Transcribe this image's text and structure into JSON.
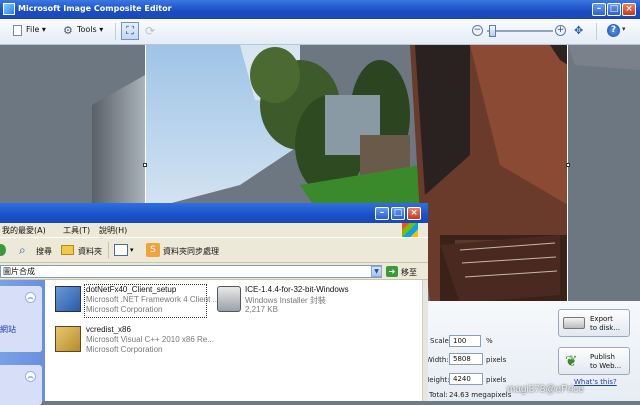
{
  "app": {
    "title": "Microsoft Image Composite Editor"
  },
  "toolbar": {
    "file_label": "File",
    "tools_label": "Tools",
    "help_glyph": "?"
  },
  "icons": {
    "app": "ice-app-icon",
    "file": "document-icon",
    "tools": "gear-icon",
    "crop": "crop-icon",
    "rotate": "rotate-icon",
    "zoom_out": "zoom-out-icon",
    "zoom_in": "zoom-in-icon",
    "fit": "fit-to-window-icon",
    "help": "help-icon",
    "export": "disk-icon",
    "publish": "plant-icon"
  },
  "zoom": {
    "level": 0.06
  },
  "export": {
    "scale_label": "Scale:",
    "scale_value": "100",
    "scale_unit": "%",
    "width_label": "Width:",
    "width_value": "5808",
    "width_unit": "pixels",
    "height_label": "Height:",
    "height_value": "4240",
    "height_unit": "pixels",
    "total_label": "Total:",
    "total_value": "24.63 megapixels",
    "export_btn": {
      "line1": "Export",
      "line2": "to disk..."
    },
    "publish_btn": {
      "line1": "Publish",
      "line2": "to Web..."
    },
    "whats_this": "What's this?"
  },
  "watermark": "magi378@ePrice",
  "explorer": {
    "menu": [
      "我的最愛(A)",
      "工具(T)",
      "說明(H)"
    ],
    "toolbar": {
      "search": "搜尋",
      "folders": "資料夾",
      "sync": "資料夾同步處理"
    },
    "address": "圖片合成",
    "go_label": "移至",
    "files": [
      {
        "name": "dotNetFx40_Client_setup",
        "line2": "Microsoft .NET Framework 4 Client ...",
        "line3": "Microsoft Corporation"
      },
      {
        "name": "ICE-1.4.4-for-32-bit-Windows",
        "line2": "Windows Installer 封裝",
        "line3": "2,217 KB"
      },
      {
        "name": "vcredist_x86",
        "line2": "Microsoft Visual C++ 2010  x86 Re...",
        "line3": "Microsoft Corporation"
      }
    ],
    "left_partial": "網站"
  },
  "colors": {
    "titlebar": "#1c4fc4",
    "close": "#c8381a",
    "explorer_bg": "#ece9d8"
  }
}
